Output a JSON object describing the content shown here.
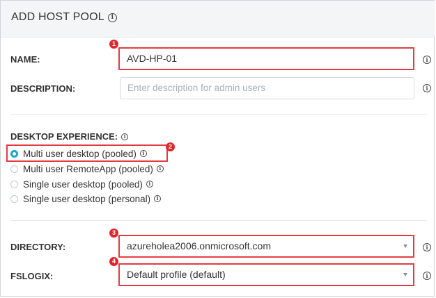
{
  "header": {
    "title": "ADD HOST POOL"
  },
  "form": {
    "name_label": "NAME:",
    "name_value": "AVD-HP-01",
    "description_label": "DESCRIPTION:",
    "description_placeholder": "Enter description for admin users",
    "desktop_experience_label": "DESKTOP EXPERIENCE:",
    "options": [
      {
        "label": "Multi user desktop (pooled)",
        "selected": true
      },
      {
        "label": "Multi user RemoteApp (pooled)",
        "selected": false
      },
      {
        "label": "Single user desktop (pooled)",
        "selected": false
      },
      {
        "label": "Single user desktop (personal)",
        "selected": false
      }
    ],
    "directory_label": "DIRECTORY:",
    "directory_value": "azureholea2006.onmicrosoft.com",
    "fslogix_label": "FSLOGIX:",
    "fslogix_value": "Default profile (default)"
  },
  "callouts": [
    "1",
    "2",
    "3",
    "4"
  ],
  "colors": {
    "highlight": "#e23c42",
    "radio_accent": "#1aa4d3",
    "badge": "#e2262d"
  },
  "icons": {
    "info": "info-circle-icon",
    "dropdown": "caret-down-icon"
  }
}
